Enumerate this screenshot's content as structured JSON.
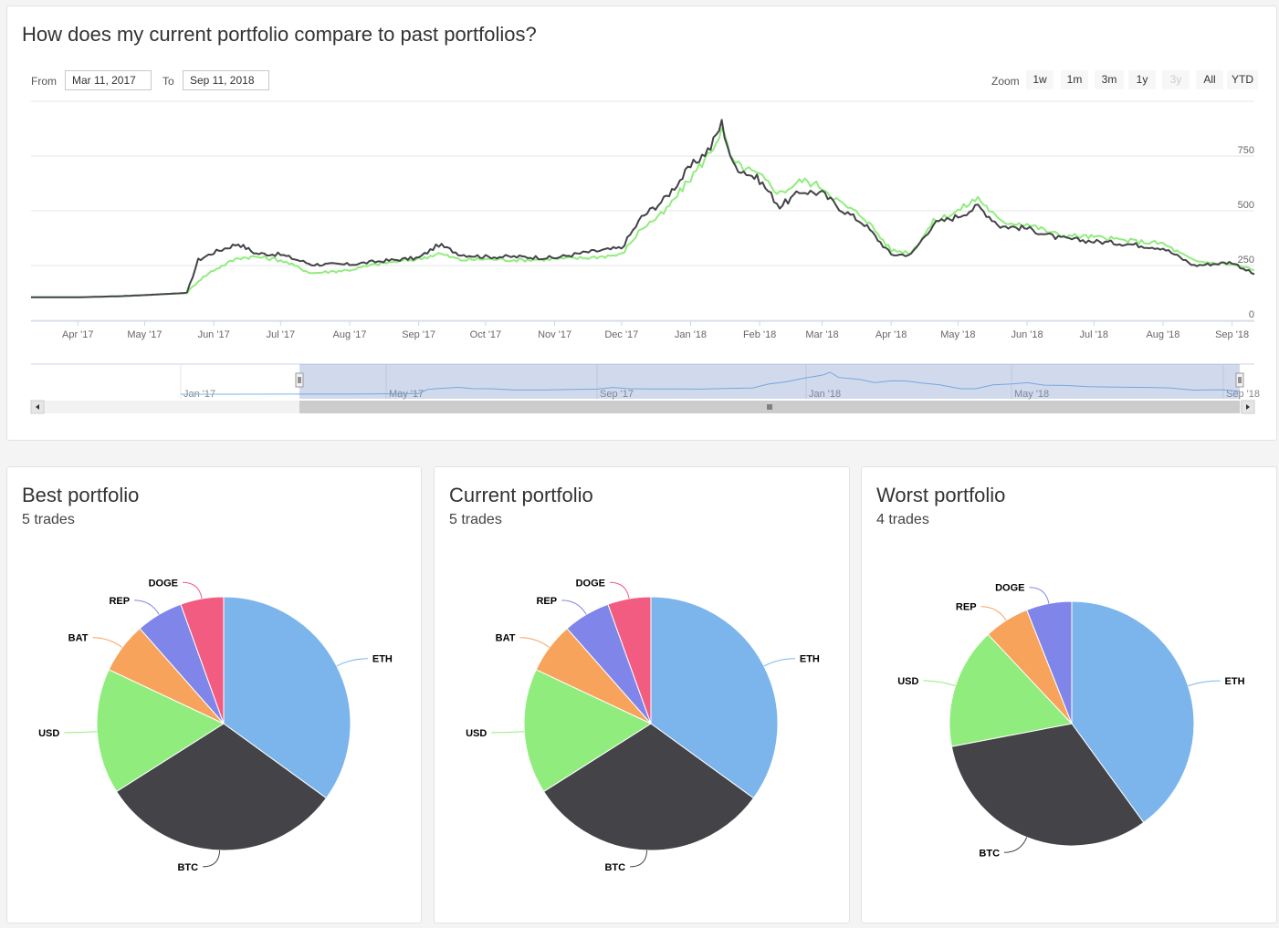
{
  "compare": {
    "title": "How does my current portfolio compare to past portfolios?",
    "from_label": "From",
    "from_value": "Mar 11, 2017",
    "to_label": "To",
    "to_value": "Sep 11, 2018",
    "zoom_label": "Zoom",
    "zoom_buttons": [
      {
        "label": "1w",
        "enabled": true
      },
      {
        "label": "1m",
        "enabled": true
      },
      {
        "label": "3m",
        "enabled": true
      },
      {
        "label": "1y",
        "enabled": true
      },
      {
        "label": "3y",
        "enabled": false
      },
      {
        "label": "All",
        "enabled": true
      },
      {
        "label": "YTD",
        "enabled": true
      }
    ]
  },
  "chart_data": {
    "type": "line",
    "y_ticks": [
      "0",
      "250",
      "500",
      "750"
    ],
    "ylim": [
      0,
      1000
    ],
    "x_ticks": [
      "Apr '17",
      "May '17",
      "Jun '17",
      "Jul '17",
      "Aug '17",
      "Sep '17",
      "Oct '17",
      "Nov '17",
      "Dec '17",
      "Jan '18",
      "Feb '18",
      "Mar '18",
      "Apr '18",
      "May '18",
      "Jun '18",
      "Jul '18",
      "Aug '18",
      "Sep '18"
    ],
    "navigator_ticks": [
      "Jan '17",
      "May '17",
      "Sep '17",
      "Jan '18",
      "May '18",
      "Sep '18"
    ],
    "dates": [
      "2017-03-11",
      "2017-04-01",
      "2017-04-20",
      "2017-05-01",
      "2017-05-20",
      "2017-05-25",
      "2017-06-01",
      "2017-06-12",
      "2017-06-20",
      "2017-07-01",
      "2017-07-15",
      "2017-08-01",
      "2017-08-15",
      "2017-09-01",
      "2017-09-10",
      "2017-09-20",
      "2017-10-01",
      "2017-10-15",
      "2017-11-01",
      "2017-11-15",
      "2017-12-01",
      "2017-12-10",
      "2017-12-20",
      "2018-01-01",
      "2018-01-10",
      "2018-01-15",
      "2018-01-20",
      "2018-02-01",
      "2018-02-10",
      "2018-02-20",
      "2018-03-01",
      "2018-03-10",
      "2018-03-20",
      "2018-04-01",
      "2018-04-10",
      "2018-04-20",
      "2018-05-01",
      "2018-05-10",
      "2018-05-20",
      "2018-06-01",
      "2018-06-15",
      "2018-07-01",
      "2018-07-15",
      "2018-08-01",
      "2018-08-15",
      "2018-09-01",
      "2018-09-11"
    ],
    "series": [
      {
        "color": "#434348",
        "values": [
          105,
          105,
          110,
          115,
          125,
          275,
          310,
          350,
          305,
          300,
          255,
          255,
          270,
          285,
          345,
          300,
          290,
          290,
          285,
          310,
          330,
          470,
          550,
          700,
          790,
          900,
          710,
          640,
          520,
          590,
          580,
          505,
          440,
          300,
          300,
          440,
          475,
          520,
          430,
          420,
          375,
          360,
          350,
          330,
          250,
          265,
          210
        ]
      },
      {
        "color": "#90ed7d",
        "values": [
          105,
          105,
          110,
          115,
          125,
          180,
          230,
          285,
          290,
          275,
          215,
          230,
          260,
          280,
          305,
          275,
          280,
          275,
          280,
          285,
          300,
          420,
          490,
          650,
          770,
          870,
          720,
          660,
          580,
          640,
          610,
          530,
          470,
          320,
          310,
          450,
          500,
          560,
          450,
          440,
          390,
          380,
          365,
          350,
          270,
          255,
          230
        ]
      }
    ]
  },
  "pies": [
    {
      "title": "Best portfolio",
      "subtitle": "5 trades",
      "chart_data": {
        "type": "pie",
        "slices": [
          {
            "label": "ETH",
            "value": 35,
            "color": "#7cb5ec"
          },
          {
            "label": "BTC",
            "value": 31,
            "color": "#434348"
          },
          {
            "label": "USD",
            "value": 16,
            "color": "#90ed7d"
          },
          {
            "label": "BAT",
            "value": 6.5,
            "color": "#f7a35c"
          },
          {
            "label": "REP",
            "value": 6,
            "color": "#8085e9"
          },
          {
            "label": "DOGE",
            "value": 5.5,
            "color": "#f15c80"
          }
        ]
      }
    },
    {
      "title": "Current portfolio",
      "subtitle": "5 trades",
      "chart_data": {
        "type": "pie",
        "slices": [
          {
            "label": "ETH",
            "value": 35,
            "color": "#7cb5ec"
          },
          {
            "label": "BTC",
            "value": 31,
            "color": "#434348"
          },
          {
            "label": "USD",
            "value": 16,
            "color": "#90ed7d"
          },
          {
            "label": "BAT",
            "value": 6.5,
            "color": "#f7a35c"
          },
          {
            "label": "REP",
            "value": 6,
            "color": "#8085e9"
          },
          {
            "label": "DOGE",
            "value": 5.5,
            "color": "#f15c80"
          }
        ]
      }
    },
    {
      "title": "Worst portfolio",
      "subtitle": "4 trades",
      "chart_data": {
        "type": "pie",
        "slices": [
          {
            "label": "ETH",
            "value": 40,
            "color": "#7cb5ec"
          },
          {
            "label": "BTC",
            "value": 32,
            "color": "#434348"
          },
          {
            "label": "USD",
            "value": 16,
            "color": "#90ed7d"
          },
          {
            "label": "REP",
            "value": 6,
            "color": "#f7a35c"
          },
          {
            "label": "DOGE",
            "value": 6,
            "color": "#8085e9"
          }
        ]
      }
    }
  ]
}
